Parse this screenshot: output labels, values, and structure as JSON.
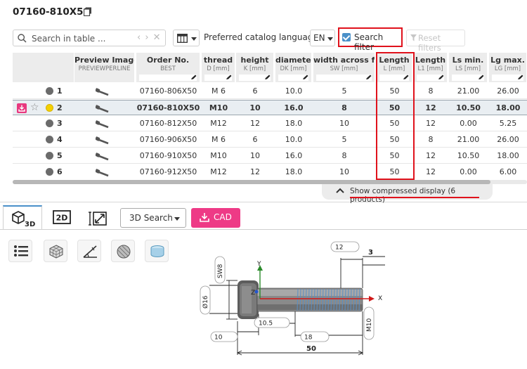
{
  "header": {
    "title": "07160-810X50"
  },
  "toolbar": {
    "search_placeholder": "Search in table ...",
    "language_label": "Preferred catalog language",
    "language_value": "EN",
    "search_filter_label": "Search filter",
    "search_filter_checked": true,
    "reset_filters_label": "Reset filters"
  },
  "columns": [
    {
      "title": "Preview Image",
      "sub": "PREVIEWPERLINE"
    },
    {
      "title": "Order No.",
      "sub": "BEST"
    },
    {
      "title": "thread",
      "sub": "D [mm]"
    },
    {
      "title": "height",
      "sub": "K [mm]"
    },
    {
      "title": "diameter",
      "sub": "DK [mm]"
    },
    {
      "title": "width across fl...",
      "sub": "SW [mm]"
    },
    {
      "title": "Length",
      "sub": "L [mm]"
    },
    {
      "title": "Length",
      "sub": "L1 [mm]"
    },
    {
      "title": "Ls min.",
      "sub": "LS [mm]"
    },
    {
      "title": "Lg max.",
      "sub": "LG [mm]"
    }
  ],
  "rows": [
    {
      "num": "1",
      "order": "07160-806X50",
      "thread": "M 6",
      "height": "6",
      "diameter": "10.0",
      "sw": "5",
      "l": "50",
      "l1": "8",
      "ls": "21.00",
      "lg": "26.00",
      "selected": false
    },
    {
      "num": "2",
      "order": "07160-810X50",
      "thread": "M10",
      "height": "10",
      "diameter": "16.0",
      "sw": "8",
      "l": "50",
      "l1": "12",
      "ls": "10.50",
      "lg": "18.00",
      "selected": true
    },
    {
      "num": "3",
      "order": "07160-812X50",
      "thread": "M12",
      "height": "12",
      "diameter": "18.0",
      "sw": "10",
      "l": "50",
      "l1": "12",
      "ls": "0.00",
      "lg": "5.25",
      "selected": false
    },
    {
      "num": "4",
      "order": "07160-906X50",
      "thread": "M 6",
      "height": "6",
      "diameter": "10.0",
      "sw": "5",
      "l": "50",
      "l1": "8",
      "ls": "21.00",
      "lg": "26.00",
      "selected": false
    },
    {
      "num": "5",
      "order": "07160-910X50",
      "thread": "M10",
      "height": "10",
      "diameter": "16.0",
      "sw": "8",
      "l": "50",
      "l1": "12",
      "ls": "10.50",
      "lg": "18.00",
      "selected": false
    },
    {
      "num": "6",
      "order": "07160-912X50",
      "thread": "M12",
      "height": "12",
      "diameter": "18.0",
      "sw": "10",
      "l": "50",
      "l1": "12",
      "ls": "0.00",
      "lg": "6.00",
      "selected": false
    }
  ],
  "compress_label": "Show compressed display (6 products)",
  "tabs": {
    "tab_3d": "3D",
    "tab_2d": "2D"
  },
  "viewer_toolbar": {
    "search3d_label": "3D Search",
    "cad_label": "CAD"
  },
  "drawing": {
    "sw": "SW8",
    "dk": "Ø16",
    "l1": "12",
    "k": "10",
    "ls": "10.5",
    "lg": "18",
    "d": "M10",
    "l": "50",
    "dim3": "3",
    "axis_x": "X",
    "axis_y": "Y",
    "axis_z": "Z"
  },
  "colors": {
    "accent_pink": "#ee3a86",
    "highlight_red": "#e0121c",
    "checkbox_blue": "#4a90c9",
    "selected_dot": "#f4d000"
  }
}
